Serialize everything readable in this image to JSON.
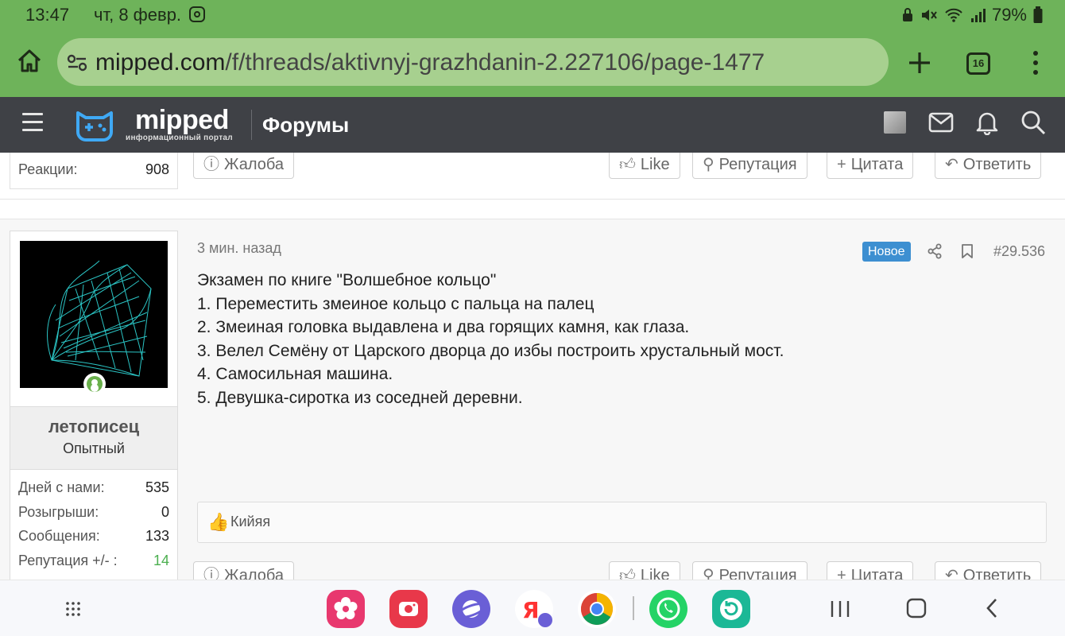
{
  "status_bar": {
    "time": "13:47",
    "date": "чт, 8 февр.",
    "battery": "79%"
  },
  "browser": {
    "url_domain": "mipped.com",
    "url_path": "/f/threads/aktivnyj-grazhdanin-2.227106/page-1477",
    "tab_count": "16"
  },
  "site": {
    "logo_text": "mipped",
    "logo_subtitle": "информационный портал",
    "section_title": "Форумы"
  },
  "prev_post": {
    "reactions_label": "Реакции:",
    "reactions_value": "908"
  },
  "actions": {
    "report": "Жалоба",
    "like": "Like",
    "reputation": "Репутация",
    "quote": "Цитата",
    "reply": "Ответить"
  },
  "post": {
    "time": "3 мин. назад",
    "new_badge": "Новое",
    "number": "#29.536",
    "lines": [
      "Экзамен по книге \"Волшебное кольцо\"",
      "1. Переместить змеиное кольцо с пальца на палец",
      "2. Змеиная головка выдавлена и два горящих камня, как глаза.",
      "3. Велел Семёну от Царского дворца до избы построить хрустальный мост.",
      "4. Самосильная машина.",
      "5. Девушка-сиротка из соседней деревни."
    ],
    "reacted_by": "Кийяя"
  },
  "author": {
    "name": "летописец",
    "title": "Опытный",
    "stats": [
      {
        "label": "Дней с нами:",
        "value": "535"
      },
      {
        "label": "Розыгрыши:",
        "value": "0"
      },
      {
        "label": "Сообщения:",
        "value": "133"
      },
      {
        "label": "Репутация +/- :",
        "value": "14"
      }
    ]
  },
  "colors": {
    "browser_green": "#6eb35a",
    "header_dark": "#3f4146",
    "accent_blue": "#3d8fd1",
    "reputation_green": "#4caf50"
  }
}
